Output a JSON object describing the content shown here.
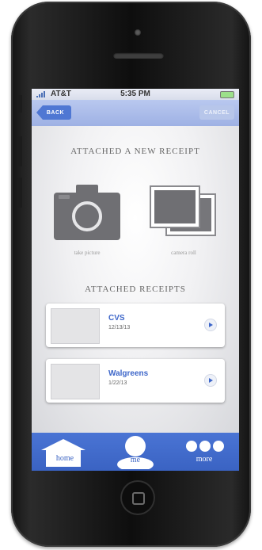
{
  "status_bar": {
    "carrier": "AT&T",
    "time": "5:35 PM"
  },
  "nav": {
    "back_label": "BACK",
    "cancel_label": "CANCEL"
  },
  "attach_new": {
    "title": "ATTACHED A NEW RECEIPT",
    "options": [
      {
        "label": "take picture",
        "icon": "camera-icon"
      },
      {
        "label": "camera roll",
        "icon": "photo-stack-icon"
      }
    ]
  },
  "attached": {
    "title": "ATTACHED RECEIPTS",
    "receipts": [
      {
        "store": "CVS",
        "date": "12/13/13"
      },
      {
        "store": "Walgreens",
        "date": "1/22/13"
      }
    ]
  },
  "tabs": [
    {
      "label": "home",
      "icon": "house-icon"
    },
    {
      "label": "me",
      "icon": "person-icon"
    },
    {
      "label": "more",
      "icon": "ellipsis-icon"
    }
  ],
  "colors": {
    "accent_blue": "#4a74d4",
    "nav_bar": "#a9bbe8",
    "link_blue": "#3d66c9"
  }
}
